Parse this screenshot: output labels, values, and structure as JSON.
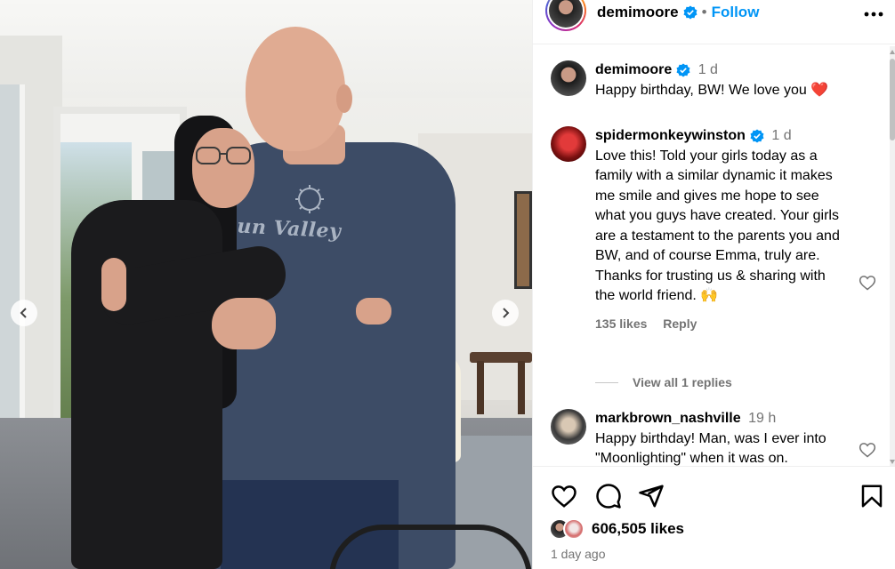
{
  "post": {
    "username": "demimoore",
    "dot": "•",
    "follow_label": "Follow",
    "more_icon": "more-horizontal-icon",
    "likes_count": "606,505 likes",
    "posted_ago": "1 day ago"
  },
  "photo": {
    "shirt_text": "Sun Valley",
    "carousel_prev_icon": "chevron-left-icon",
    "carousel_next_icon": "chevron-right-icon"
  },
  "comments": [
    {
      "username": "demimoore",
      "time": "1 d",
      "verified": true,
      "text": "Happy birthday, BW! We love you ❤️"
    },
    {
      "username": "spidermonkeywinston",
      "time": "1 d",
      "verified": true,
      "text": "Love this! Told your girls today as a family with a similar dynamic it makes me smile and gives me hope to see what you guys have created. Your girls are a testament to the parents you and BW, and of course Emma, truly are. Thanks for trusting us & sharing with the world friend. 🙌",
      "likes": "135 likes",
      "reply_label": "Reply",
      "view_replies": "View all 1 replies"
    },
    {
      "username": "markbrown_nashville",
      "time": "19 h",
      "verified": false,
      "text": "Happy birthday! Man, was I ever into \"Moonlighting\" when it was on."
    }
  ],
  "colors": {
    "link_blue": "#0095f6",
    "muted": "#737373",
    "heart_red": "#ed4956"
  }
}
